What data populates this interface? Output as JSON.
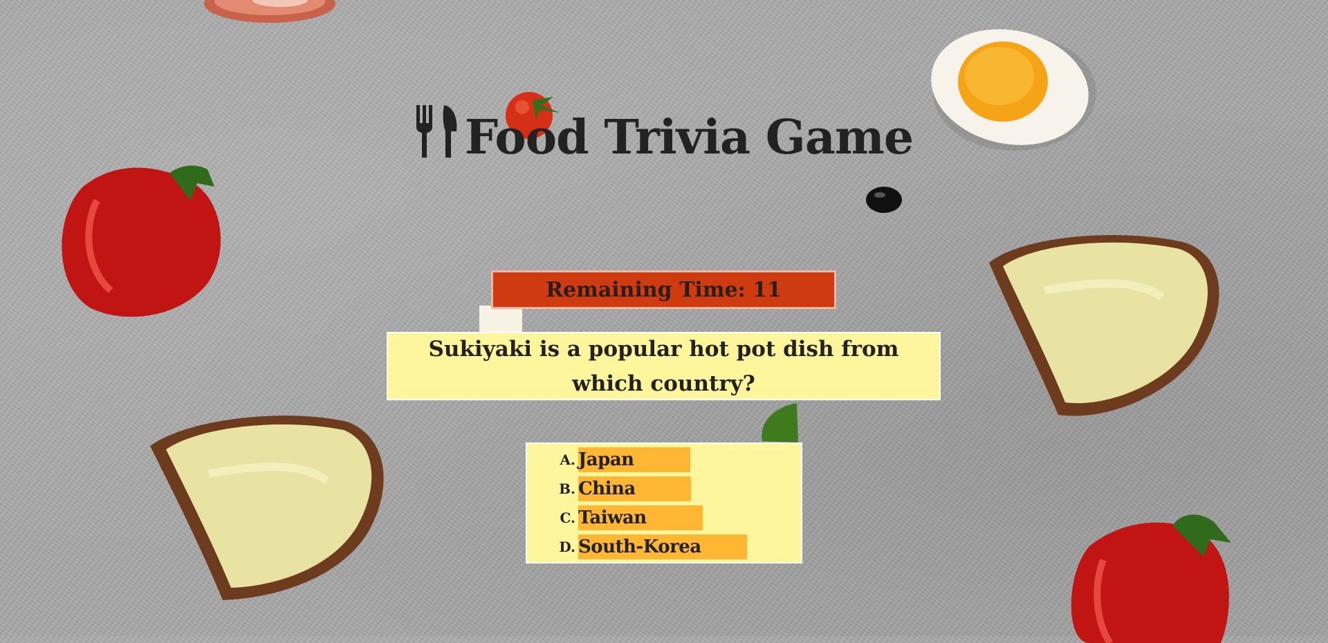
{
  "header": {
    "title": "Food Trivia Game",
    "icon": "utensils-icon"
  },
  "timer": {
    "label": "Remaining Time: 11",
    "color": "#cf3b10"
  },
  "question": {
    "text": "Sukiyaki is a popular hot pot dish from which country?"
  },
  "answers": [
    {
      "letter": "A.",
      "label": "Japan"
    },
    {
      "letter": "B.",
      "label": "China"
    },
    {
      "letter": "C.",
      "label": "Taiwan"
    },
    {
      "letter": "D.",
      "label": "South-Korea"
    }
  ],
  "colors": {
    "question_bg": "#fff59d",
    "answer_highlight": "#ffb733"
  }
}
